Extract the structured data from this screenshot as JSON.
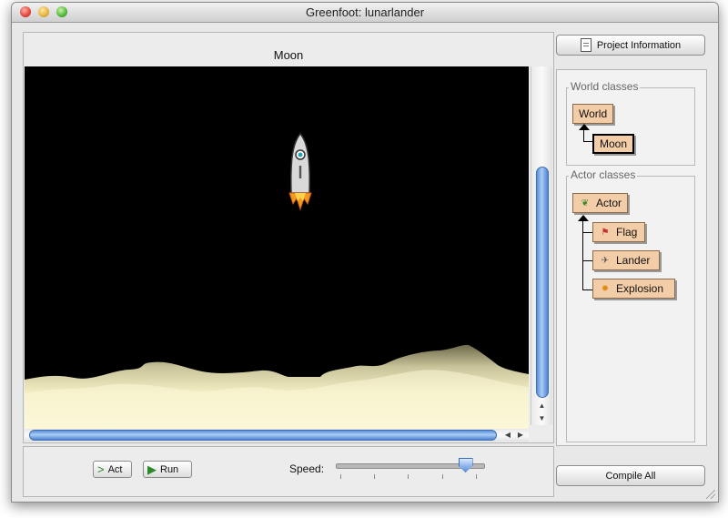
{
  "window": {
    "title": "Greenfoot: lunarlander"
  },
  "world": {
    "name": "Moon"
  },
  "controls": {
    "act_label": "Act",
    "run_label": "Run",
    "speed_label": "Speed:",
    "speed_level": 0.88
  },
  "sidebar": {
    "project_info_label": "Project Information",
    "world_classes_title": "World classes",
    "world_classes": [
      {
        "name": "World",
        "selected": false
      },
      {
        "name": "Moon",
        "selected": true
      }
    ],
    "actor_classes_title": "Actor classes",
    "actor_classes": [
      {
        "name": "Actor",
        "icon": "actor-icon"
      },
      {
        "name": "Flag",
        "icon": "flag-icon"
      },
      {
        "name": "Lander",
        "icon": "lander-icon"
      },
      {
        "name": "Explosion",
        "icon": "explosion-icon"
      }
    ],
    "compile_label": "Compile All"
  },
  "colors": {
    "space": "#000000",
    "moon_surface": "#f6f1c3",
    "class_box": "#f3cda7",
    "scroll_blue": "#5a8fd8"
  }
}
